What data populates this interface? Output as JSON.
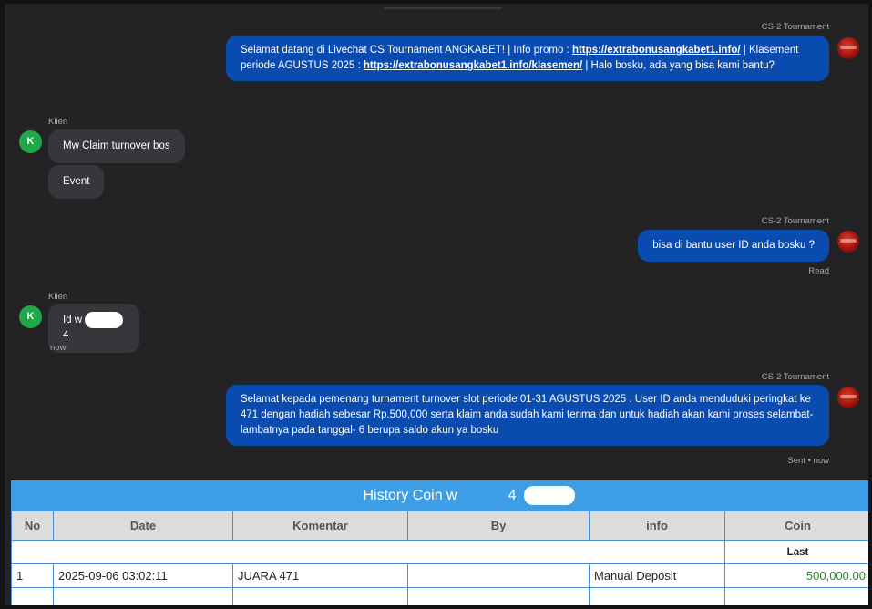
{
  "chat": {
    "messages": [
      {
        "sender": "CS-2 Tournament",
        "text_a": "Selamat datang di Livechat CS Tournament ANGKABET! | Info promo : ",
        "link_1": "https://extrabonusangkabet1.info/",
        "text_b": " | Klasement periode AGUSTUS 2025 : ",
        "link_2": "https://extrabonusangkabet1.info/klasemen/",
        "text_c": " | Halo bosku, ada yang bisa kami bantu?"
      },
      {
        "sender": "Klien",
        "avatar": "K",
        "lines": [
          "Mw Claim turnover bos",
          "Event"
        ]
      },
      {
        "sender": "CS-2 Tournament",
        "text": "bisa di bantu user ID anda bosku ?",
        "status": "Read"
      },
      {
        "sender": "Klien",
        "avatar": "K",
        "text_prefix": "Id w",
        "text_suffix": "4",
        "time": "now"
      },
      {
        "sender": "CS-2 Tournament",
        "text": "Selamat kepada pemenang turnament turnover slot periode 01-31 AGUSTUS 2025 . User ID anda menduduki peringkat ke 471 dengan hadiah sebesar Rp.500,000 serta klaim anda sudah kami terima dan untuk hadiah akan kami proses selambat-lambatnya pada tanggal- 6 berupa saldo akun ya bosku",
        "status": "Sent • now"
      }
    ]
  },
  "history": {
    "title_prefix": "History Coin w",
    "title_suffix": "4",
    "columns": [
      "No",
      "Date",
      "Komentar",
      "By",
      "info",
      "Coin"
    ],
    "summary_label": "Last",
    "rows": [
      {
        "no": "1",
        "date": "2025-09-06 03:02:11",
        "komentar": "JUARA 471",
        "by": "",
        "info": "Manual Deposit",
        "coin": "500,000.00"
      }
    ]
  },
  "colors": {
    "background": "#232325",
    "agent_bubble": "#0a4bb0",
    "client_bubble": "#37373b",
    "client_avatar": "#1ea84a",
    "history_header": "#3d9ee6",
    "coin_text": "#2c8a2c"
  }
}
